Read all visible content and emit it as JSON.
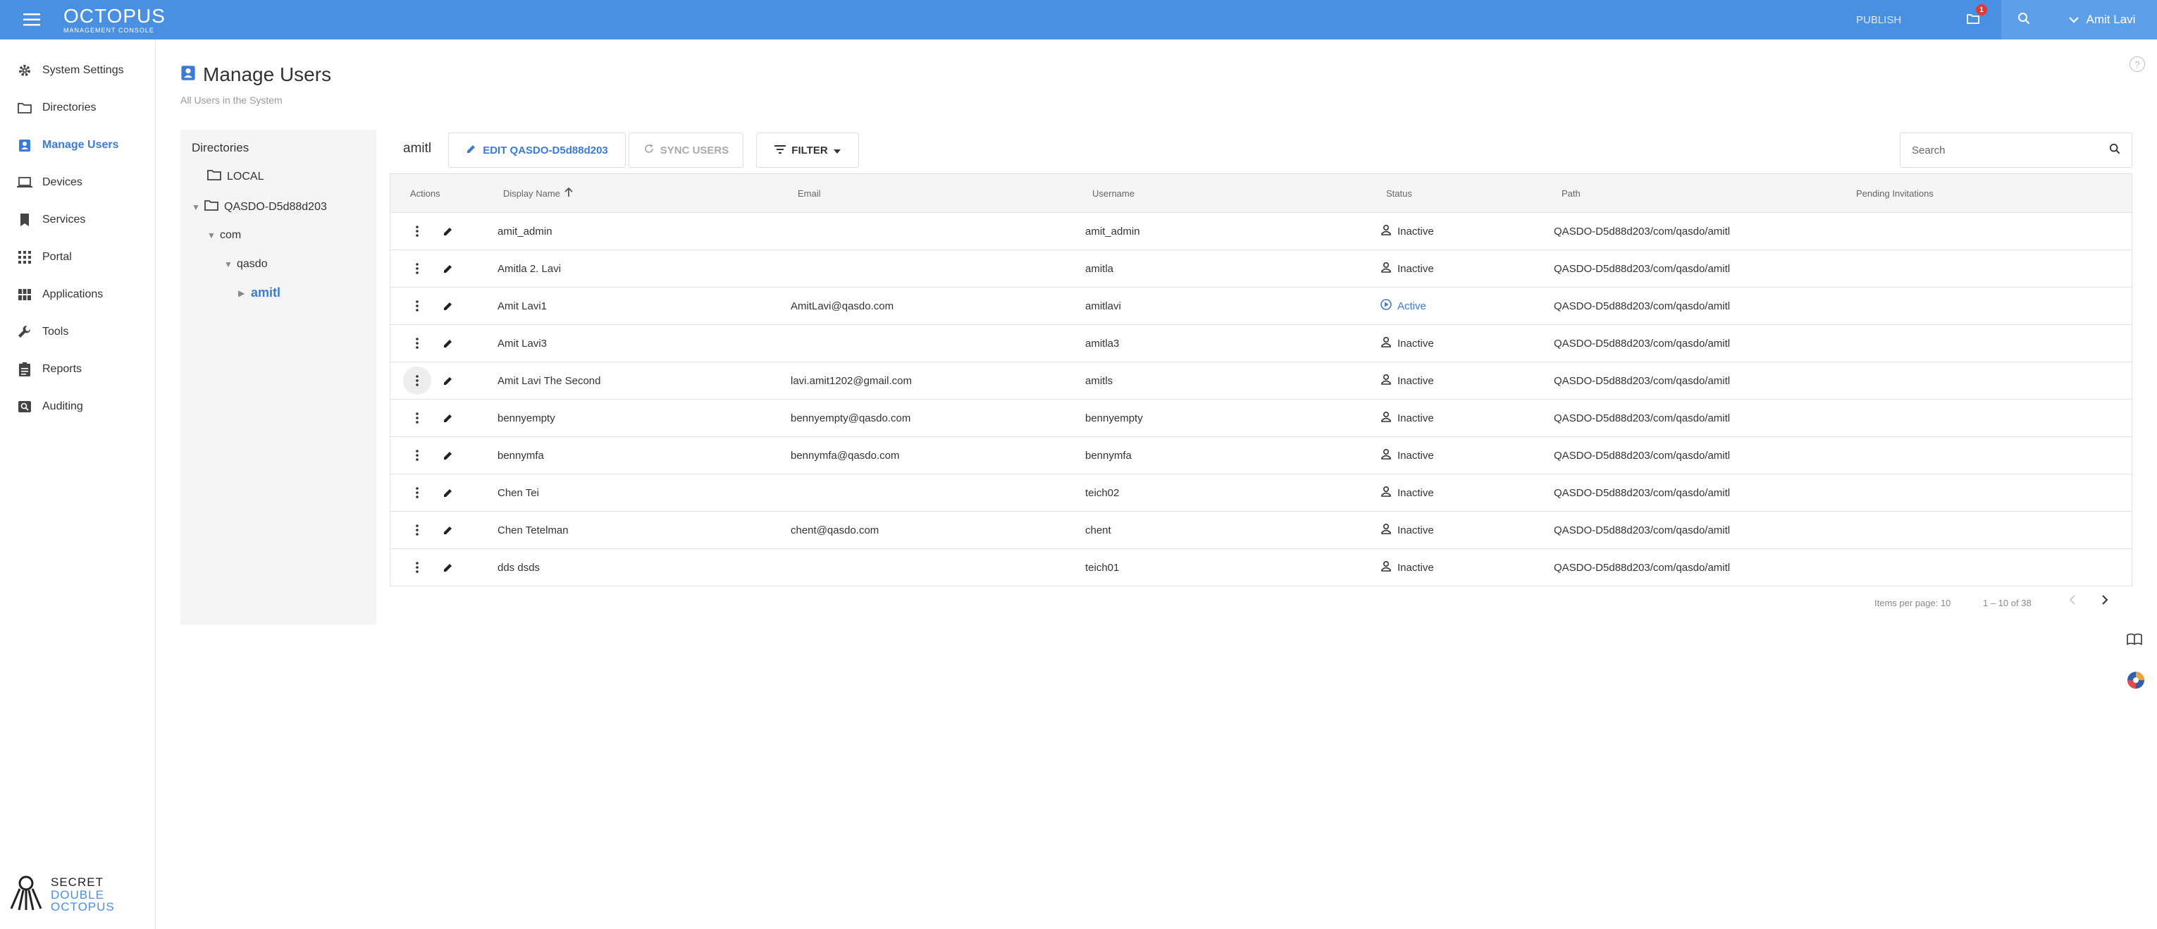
{
  "header": {
    "brand_title": "OCTOPUS",
    "brand_subtitle": "MANAGEMENT CONSOLE",
    "publish_label": "PUBLISH",
    "notification_count": "1",
    "user_name": "Amit Lavi",
    "accent_color": "#4a90e2"
  },
  "sidebar": {
    "items": [
      {
        "label": "System Settings",
        "icon": "gear-icon"
      },
      {
        "label": "Directories",
        "icon": "folder-icon"
      },
      {
        "label": "Manage Users",
        "icon": "user-badge-icon",
        "active": true
      },
      {
        "label": "Devices",
        "icon": "laptop-icon"
      },
      {
        "label": "Services",
        "icon": "bookmark-icon"
      },
      {
        "label": "Portal",
        "icon": "grid-icon"
      },
      {
        "label": "Applications",
        "icon": "apps-icon"
      },
      {
        "label": "Tools",
        "icon": "wrench-icon"
      },
      {
        "label": "Reports",
        "icon": "clipboard-icon"
      },
      {
        "label": "Auditing",
        "icon": "audit-icon"
      }
    ],
    "logo_line1": "SECRET",
    "logo_line2": "DOUBLE",
    "logo_line3": "OCTOPUS"
  },
  "page": {
    "title": "Manage Users",
    "subtitle": "All Users in the System"
  },
  "directories": {
    "title": "Directories",
    "nodes": [
      {
        "label": "LOCAL"
      },
      {
        "label": "QASDO-D5d88d203"
      },
      {
        "label": "com"
      },
      {
        "label": "qasdo"
      },
      {
        "label": "amitl"
      }
    ]
  },
  "toolbar": {
    "current_dir": "amitl",
    "edit_label": "EDIT QASDO-D5d88d203",
    "sync_label": "SYNC USERS",
    "filter_label": "FILTER",
    "search_placeholder": "Search"
  },
  "table": {
    "columns": {
      "actions": "Actions",
      "display_name": "Display Name",
      "email": "Email",
      "username": "Username",
      "status": "Status",
      "path": "Path",
      "pending": "Pending Invitations"
    },
    "rows": [
      {
        "name": "amit_admin",
        "email": "",
        "username": "amit_admin",
        "status": "Inactive",
        "path": "QASDO-D5d88d203/com/qasdo/amitl"
      },
      {
        "name": "Amitla 2. Lavi",
        "email": "",
        "username": "amitla",
        "status": "Inactive",
        "path": "QASDO-D5d88d203/com/qasdo/amitl"
      },
      {
        "name": "Amit Lavi1",
        "email": "AmitLavi@qasdo.com",
        "username": "amitlavi",
        "status": "Active",
        "path": "QASDO-D5d88d203/com/qasdo/amitl"
      },
      {
        "name": "Amit Lavi3",
        "email": "",
        "username": "amitla3",
        "status": "Inactive",
        "path": "QASDO-D5d88d203/com/qasdo/amitl"
      },
      {
        "name": "Amit Lavi The Second",
        "email": "lavi.amit1202@gmail.com",
        "username": "amitls",
        "status": "Inactive",
        "path": "QASDO-D5d88d203/com/qasdo/amitl"
      },
      {
        "name": "bennyempty",
        "email": "bennyempty@qasdo.com",
        "username": "bennyempty",
        "status": "Inactive",
        "path": "QASDO-D5d88d203/com/qasdo/amitl"
      },
      {
        "name": "bennymfa",
        "email": "bennymfa@qasdo.com",
        "username": "bennymfa",
        "status": "Inactive",
        "path": "QASDO-D5d88d203/com/qasdo/amitl"
      },
      {
        "name": "Chen Tei",
        "email": "",
        "username": "teich02",
        "status": "Inactive",
        "path": "QASDO-D5d88d203/com/qasdo/amitl"
      },
      {
        "name": "Chen Tetelman",
        "email": "chent@qasdo.com",
        "username": "chent",
        "status": "Inactive",
        "path": "QASDO-D5d88d203/com/qasdo/amitl"
      },
      {
        "name": "dds dsds",
        "email": "",
        "username": "teich01",
        "status": "Inactive",
        "path": "QASDO-D5d88d203/com/qasdo/amitl"
      }
    ]
  },
  "pagination": {
    "items_per_page": "Items per page: 10",
    "range": "1 – 10 of 38"
  }
}
